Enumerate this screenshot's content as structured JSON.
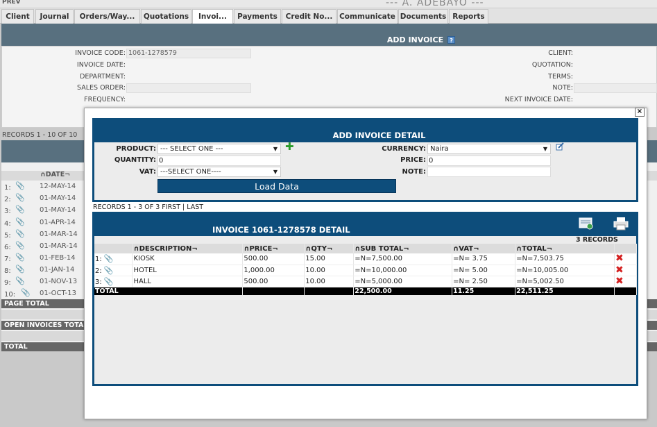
{
  "topbar": {
    "prev": "PREV",
    "user": "--- A. ADEBAYO ---"
  },
  "tabs": [
    "Client",
    "Journal",
    "Orders/Way...",
    "Quotations",
    "Invoi...",
    "Payments",
    "Credit No...",
    "Communicate",
    "Documents",
    "Reports"
  ],
  "background": {
    "title": "ADD INVOICE",
    "help": "?",
    "left_labels": [
      "INVOICE CODE:",
      "INVOICE DATE:",
      "DEPARTMENT:",
      "SALES ORDER:",
      "FREQUENCY:"
    ],
    "invoice_code_value": "1061-1278579",
    "right_labels": [
      "CLIENT:",
      "QUOTATION:",
      "TERMS:",
      "NOTE:",
      "NEXT INVOICE DATE:"
    ],
    "records": "RECORDS 1 - 10 OF 10",
    "date_header": "∩DATE¬",
    "rows": [
      {
        "n": "1:",
        "date": "12-MAY-14"
      },
      {
        "n": "2:",
        "date": "01-MAY-14"
      },
      {
        "n": "3:",
        "date": "01-MAY-14"
      },
      {
        "n": "4:",
        "date": "01-APR-14"
      },
      {
        "n": "5:",
        "date": "01-MAR-14"
      },
      {
        "n": "6:",
        "date": "01-MAR-14"
      },
      {
        "n": "7:",
        "date": "01-FEB-14"
      },
      {
        "n": "8:",
        "date": "01-JAN-14"
      },
      {
        "n": "9:",
        "date": "01-NOV-13"
      },
      {
        "n": "10:",
        "date": "01-OCT-13"
      }
    ],
    "page_total": "PAGE TOTAL",
    "open_invoices_total": "OPEN INVOICES TOTAL",
    "total": "TOTAL"
  },
  "modal": {
    "close": "×",
    "add_detail_title": "ADD INVOICE DETAIL",
    "labels": {
      "product": "PRODUCT:",
      "quantity": "QUANTITY:",
      "vat": "VAT:",
      "currency": "CURRENCY:",
      "price": "PRICE:",
      "note": "NOTE:"
    },
    "product_value": "--- SELECT ONE ---",
    "quantity_value": "0",
    "vat_value": "---SELECT ONE----",
    "currency_value": "Naira",
    "price_value": "0",
    "note_value": "",
    "load_button": "Load Data",
    "records": "RECORDS 1 - 3 OF 3",
    "first": "FIRST",
    "sep": "|",
    "last": "LAST",
    "detail_title": "INVOICE 1061-1278578 DETAIL",
    "record_count": "3 RECORDS",
    "columns": [
      "∩DESCRIPTION¬",
      "∩PRICE¬",
      "∩QTY¬",
      "∩SUB TOTAL¬",
      "∩VAT¬",
      "∩TOTAL¬"
    ],
    "items": [
      {
        "n": "1:",
        "description": "KIOSK",
        "price": "500.00",
        "qty": "15.00",
        "subtotal": "=N=7,500.00",
        "vat": "=N= 3.75",
        "total": "=N=7,503.75"
      },
      {
        "n": "2:",
        "description": "HOTEL",
        "price": "1,000.00",
        "qty": "10.00",
        "subtotal": "=N=10,000.00",
        "vat": "=N= 5.00",
        "total": "=N=10,005.00"
      },
      {
        "n": "3:",
        "description": "HALL",
        "price": "500.00",
        "qty": "10.00",
        "subtotal": "=N=5,000.00",
        "vat": "=N= 2.50",
        "total": "=N=5,002.50"
      }
    ],
    "totals": {
      "label": "TOTAL",
      "subtotal": "22,500.00",
      "vat": "11.25",
      "total": "22,511.25"
    }
  }
}
